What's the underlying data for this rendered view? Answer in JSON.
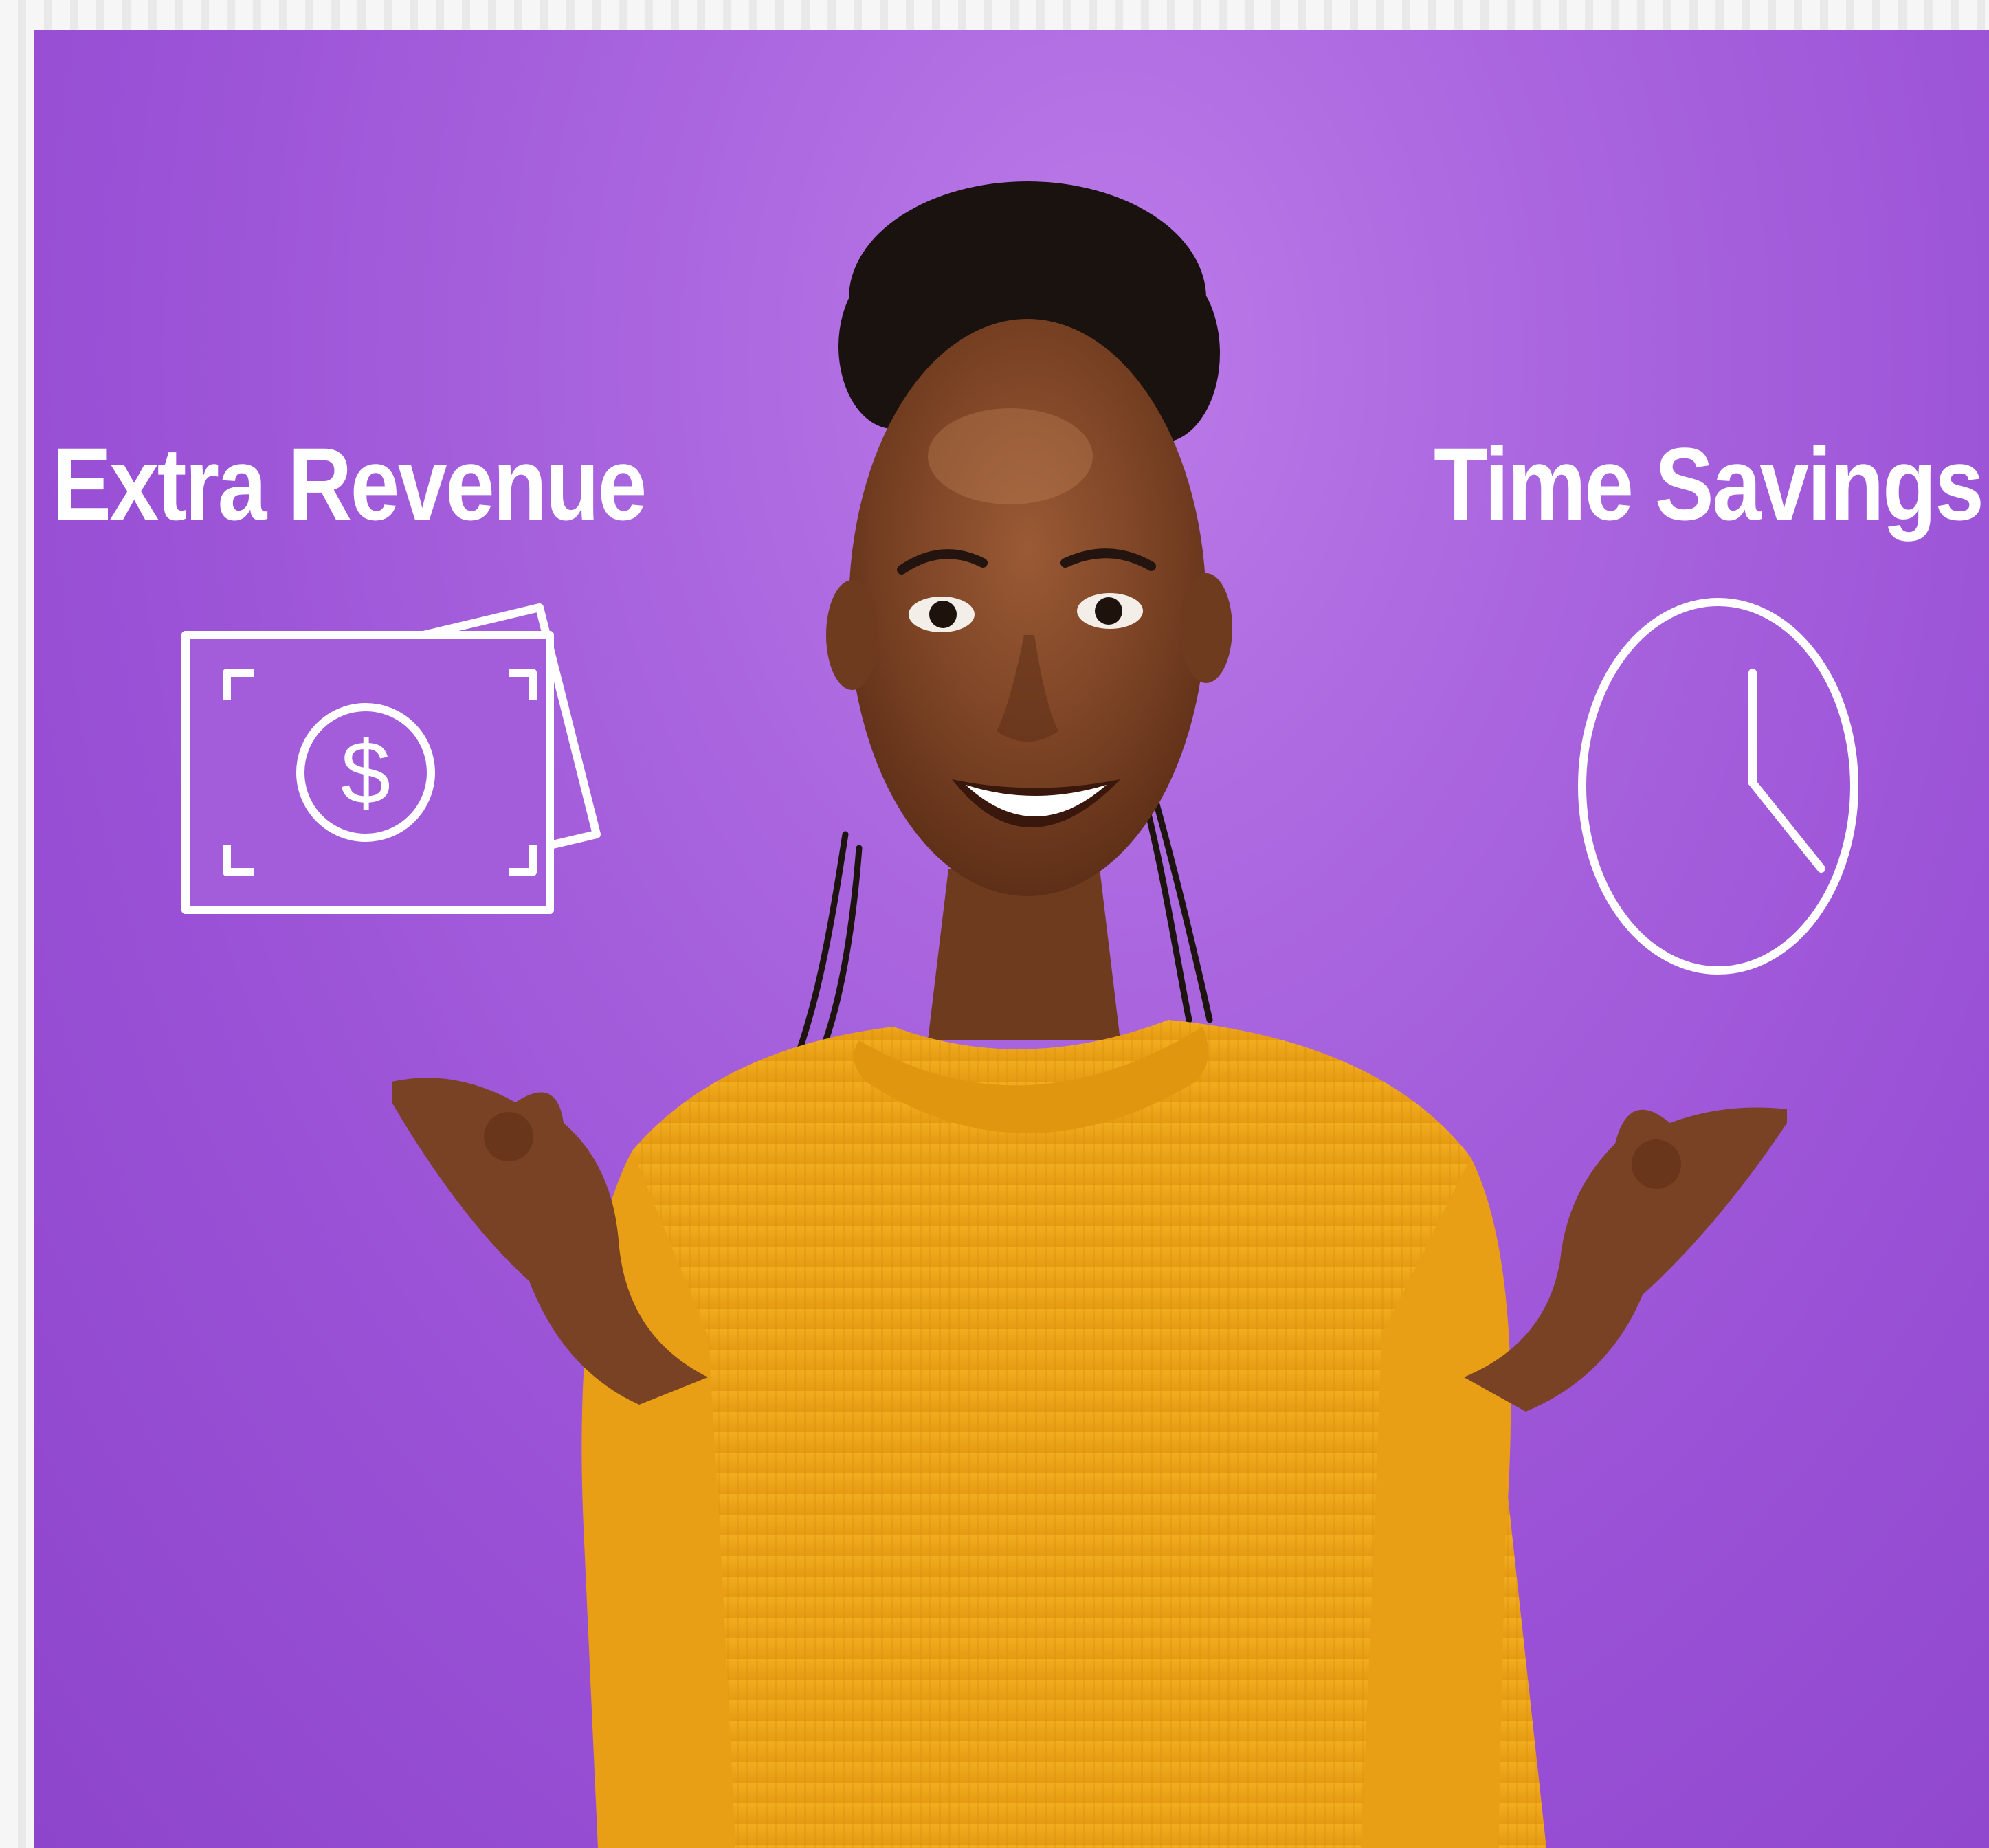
{
  "captions": {
    "left": "Extra Revenue",
    "right": "Time Savings"
  },
  "icons": {
    "left": "money-bills-icon",
    "right": "clock-icon"
  },
  "colors": {
    "background": "#a35ddb",
    "sweater": "#eea51b",
    "text": "#ffffff"
  }
}
